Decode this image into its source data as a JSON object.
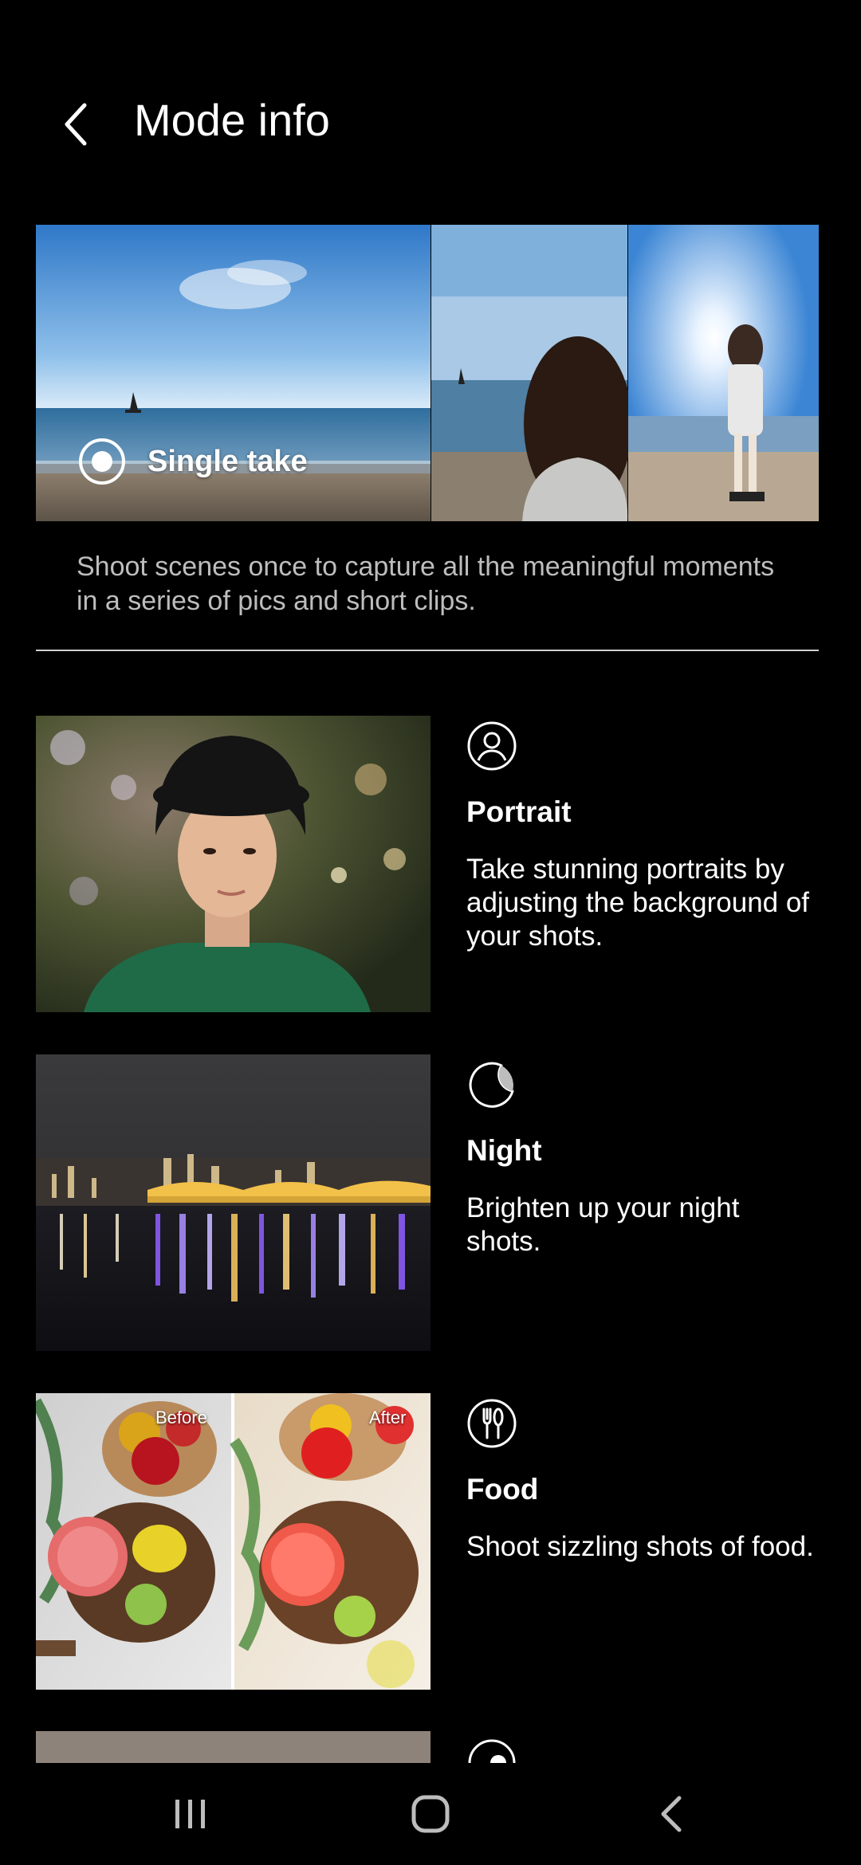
{
  "header": {
    "title": "Mode info",
    "back_icon": "chevron-left-icon"
  },
  "hero": {
    "label": "Single take",
    "description": "Shoot scenes once to capture all the meaningful moments in a series of pics and short clips.",
    "icon": "single-take-icon"
  },
  "modes": [
    {
      "name": "Portrait",
      "description": "Take stunning portraits by adjusting the background of your shots.",
      "icon": "portrait-icon"
    },
    {
      "name": "Night",
      "description": "Brighten up your night shots.",
      "icon": "moon-icon"
    },
    {
      "name": "Food",
      "description": "Shoot sizzling shots of food.",
      "icon": "fork-knife-icon",
      "before_label": "Before",
      "after_label": "After"
    }
  ],
  "navbar": {
    "recent": "recent-apps-icon",
    "home": "home-icon",
    "back": "back-icon"
  }
}
